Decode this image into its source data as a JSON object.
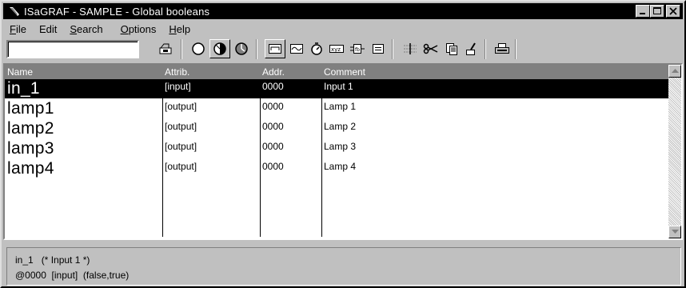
{
  "window": {
    "title": "ISaGRAF - SAMPLE - Global booleans"
  },
  "menu": [
    {
      "pre": "",
      "u": "F",
      "post": "ile"
    },
    {
      "pre": "Edit",
      "u": "",
      "post": ""
    },
    {
      "pre": "",
      "u": "S",
      "post": "earch"
    },
    {
      "pre": "",
      "u": "O",
      "post": "ptions"
    },
    {
      "pre": "",
      "u": "H",
      "post": "elp"
    }
  ],
  "toolbar": {
    "filter_value": "",
    "icons": [
      "open-folder-icon",
      "circle-empty-icon",
      "circle-half-icon",
      "circle-quarter-icon",
      "variable-icon",
      "wave-icon",
      "timer-icon",
      "xyz-icon",
      "function-block-icon",
      "equals-icon",
      "insert-line-icon",
      "cut-icon",
      "copy-icon",
      "edit-brush-icon",
      "print-icon"
    ]
  },
  "table": {
    "headers": {
      "name": "Name",
      "attrib": "Attrib.",
      "addr": "Addr.",
      "comment": "Comment"
    },
    "rows": [
      {
        "name": "in_1",
        "attrib": "[input]",
        "addr": "0000",
        "comment": "Input 1"
      },
      {
        "name": "lamp1",
        "attrib": "[output]",
        "addr": "0000",
        "comment": "Lamp 1"
      },
      {
        "name": "lamp2",
        "attrib": "[output]",
        "addr": "0000",
        "comment": "Lamp 2"
      },
      {
        "name": "lamp3",
        "attrib": "[output]",
        "addr": "0000",
        "comment": "Lamp 3"
      },
      {
        "name": "lamp4",
        "attrib": "[output]",
        "addr": "0000",
        "comment": "Lamp 4"
      }
    ],
    "selected_index": 0
  },
  "status": {
    "line1": "in_1   (* Input 1 *)",
    "line2": "@0000  [input]  (false,true)"
  }
}
